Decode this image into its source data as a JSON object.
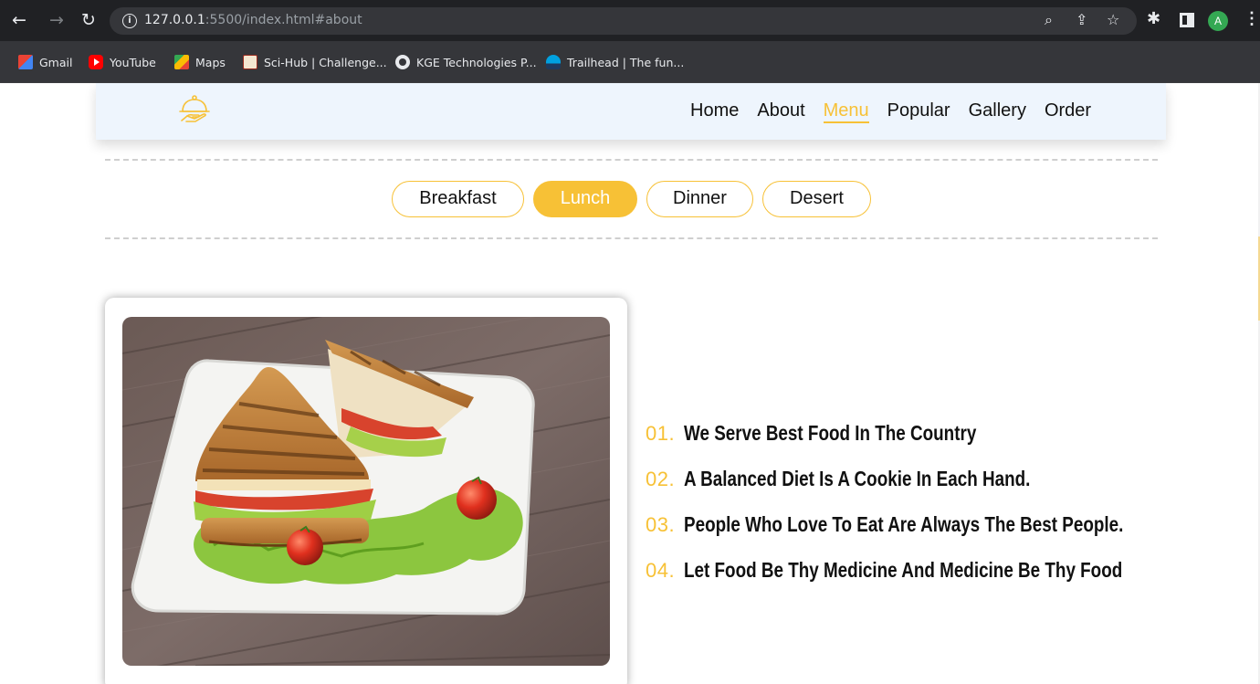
{
  "browser": {
    "url_host": "127.0.0.1",
    "url_rest": ":5500/index.html#about",
    "avatar_letter": "A",
    "bookmarks": [
      {
        "label": "Gmail"
      },
      {
        "label": "YouTube"
      },
      {
        "label": "Maps"
      },
      {
        "label": "Sci-Hub | Challenge..."
      },
      {
        "label": "KGE Technologies P..."
      },
      {
        "label": "Trailhead | The fun..."
      }
    ]
  },
  "header": {
    "nav": [
      {
        "label": "Home"
      },
      {
        "label": "About"
      },
      {
        "label": "Menu",
        "active": true
      },
      {
        "label": "Popular"
      },
      {
        "label": "Gallery"
      },
      {
        "label": "Order"
      }
    ]
  },
  "tabs": [
    {
      "label": "Breakfast"
    },
    {
      "label": "Lunch",
      "active": true
    },
    {
      "label": "Dinner"
    },
    {
      "label": "Desert"
    }
  ],
  "quotes": [
    {
      "num": "01.",
      "text": "We Serve Best Food In The Country"
    },
    {
      "num": "02.",
      "text": "A Balanced Diet Is A Cookie In Each Hand."
    },
    {
      "num": "03.",
      "text": "People Who Love To Eat Are Always The Best People."
    },
    {
      "num": "04.",
      "text": "Let Food Be Thy Medicine And Medicine Be Thy Food"
    }
  ],
  "colors": {
    "accent": "#f7c136",
    "header_bg": "#eef5fd",
    "chrome_dark": "#202124"
  }
}
